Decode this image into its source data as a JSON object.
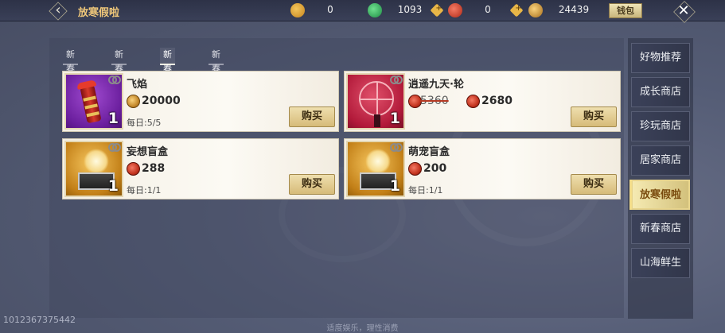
{
  "header": {
    "title": "放寒假啦",
    "wallet_label": "钱包",
    "currencies": [
      {
        "icon": "lucky-bag-icon",
        "value": "0",
        "color": "#d99a2b",
        "has_plus": false
      },
      {
        "icon": "jade-icon",
        "value": "1093",
        "color": "#2fae5d",
        "has_plus": true
      },
      {
        "icon": "red-token-icon",
        "value": "0",
        "color": "#c33a24",
        "has_plus": true
      },
      {
        "icon": "gold-coin-icon",
        "value": "24439",
        "color": "#c58a2c",
        "has_plus": false
      }
    ]
  },
  "tabs": [
    {
      "label": "新春时装",
      "active": false
    },
    {
      "label": "新春家具",
      "active": false
    },
    {
      "label": "新春玩具",
      "active": true
    },
    {
      "label": "新春成长",
      "active": false
    }
  ],
  "items": [
    {
      "name": "飞焰",
      "qty": "1",
      "currency": "gold-coin",
      "price": "20000",
      "old_price": "",
      "limit": "每日:5/5",
      "buy_label": "购买",
      "thumb": "purple",
      "icon": "firecracker-icon"
    },
    {
      "name": "逍遥九天·轮",
      "qty": "1",
      "currency": "red-coin",
      "price": "2680",
      "old_price": "5360",
      "limit": "",
      "buy_label": "购买",
      "thumb": "red",
      "icon": "ferris-wheel-icon"
    },
    {
      "name": "妄想盲盒",
      "qty": "1",
      "currency": "red-coin",
      "price": "288",
      "old_price": "",
      "limit": "每日:1/1",
      "buy_label": "购买",
      "thumb": "gold",
      "icon": "blind-box-icon"
    },
    {
      "name": "萌宠盲盒",
      "qty": "1",
      "currency": "red-coin",
      "price": "200",
      "old_price": "",
      "limit": "每日:1/1",
      "buy_label": "购买",
      "thumb": "gold",
      "icon": "pet-blind-box-icon"
    }
  ],
  "side_nav": [
    {
      "label": "好物推荐",
      "active": false
    },
    {
      "label": "成长商店",
      "active": false
    },
    {
      "label": "珍玩商店",
      "active": false
    },
    {
      "label": "居家商店",
      "active": false
    },
    {
      "label": "放寒假啦",
      "active": true
    },
    {
      "label": "新春商店",
      "active": false
    },
    {
      "label": "山海鲜生",
      "active": false
    }
  ],
  "footer": {
    "uid": "1012367375442",
    "slogan": "适度娱乐，理性消费"
  }
}
